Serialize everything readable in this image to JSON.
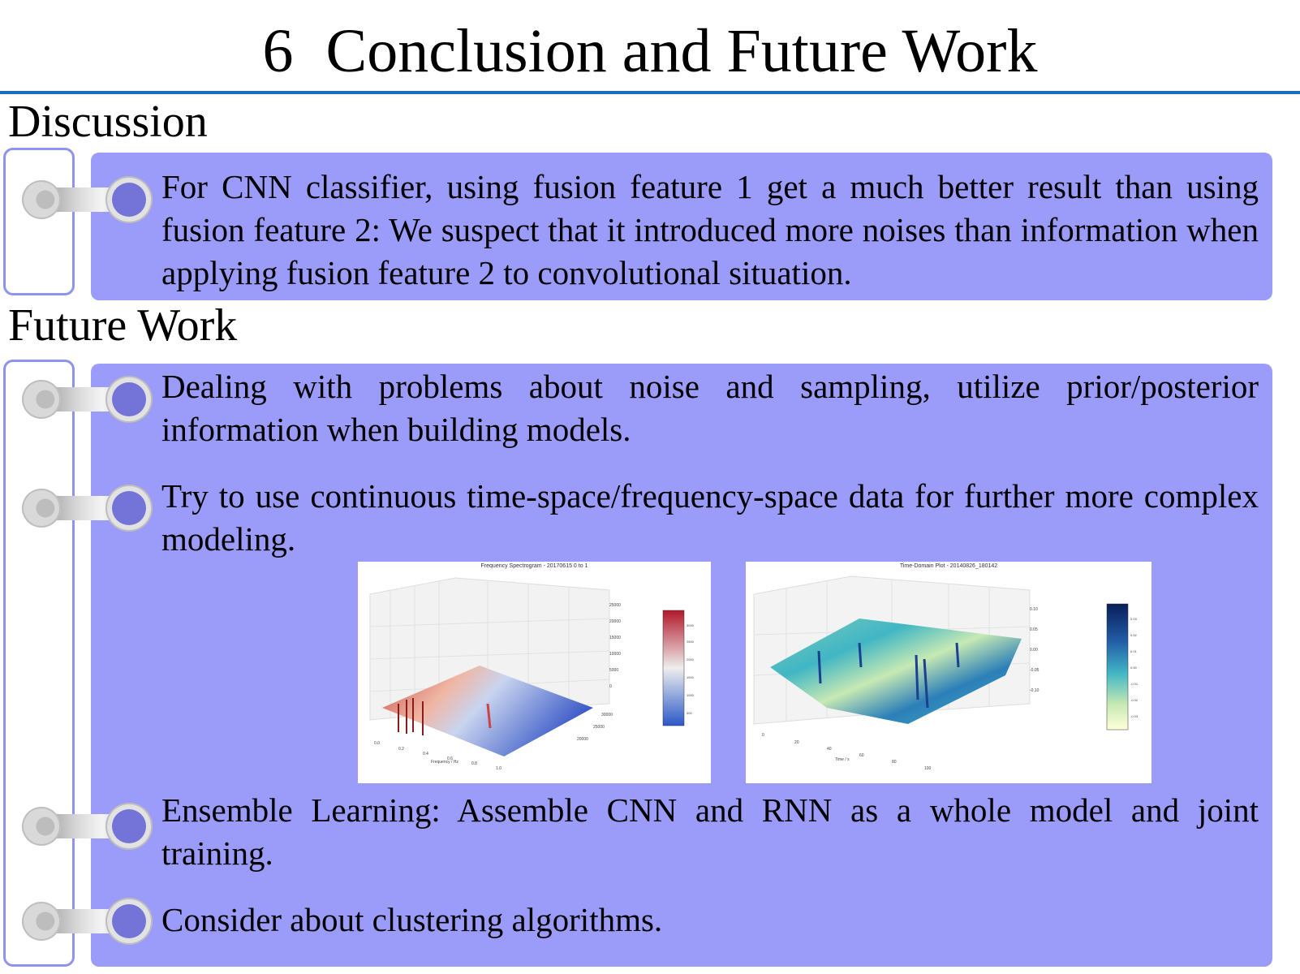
{
  "slide": {
    "number": "6",
    "title": "Conclusion and Future Work"
  },
  "discussion": {
    "heading": "Discussion",
    "items": [
      "For CNN classifier, using fusion feature 1 get a much better result than using fusion feature 2: We suspect that it introduced more noises than information when applying fusion feature 2 to convolutional situation."
    ]
  },
  "future_work": {
    "heading": "Future Work",
    "items": [
      "Dealing with problems about noise and sampling, utilize prior/posterior information when building models.",
      "Try to use continuous time-space/frequency-space data for further more complex modeling.",
      "Ensemble Learning: Assemble CNN and RNN as a whole model and joint training.",
      "Consider about clustering algorithms."
    ]
  },
  "figures": {
    "left_title": "Frequency Spectrogram - 20170615 0 to 1",
    "right_title": "Time-Domain Plot - 20140826_180142",
    "left_colormap": "red-blue (coolwarm)",
    "right_colormap": "yellow-green-blue (YlGnBu)"
  },
  "colors": {
    "panel": "#9b9bf9",
    "title_rule": "#1a6fb8",
    "bracket": "#8f93f0"
  }
}
